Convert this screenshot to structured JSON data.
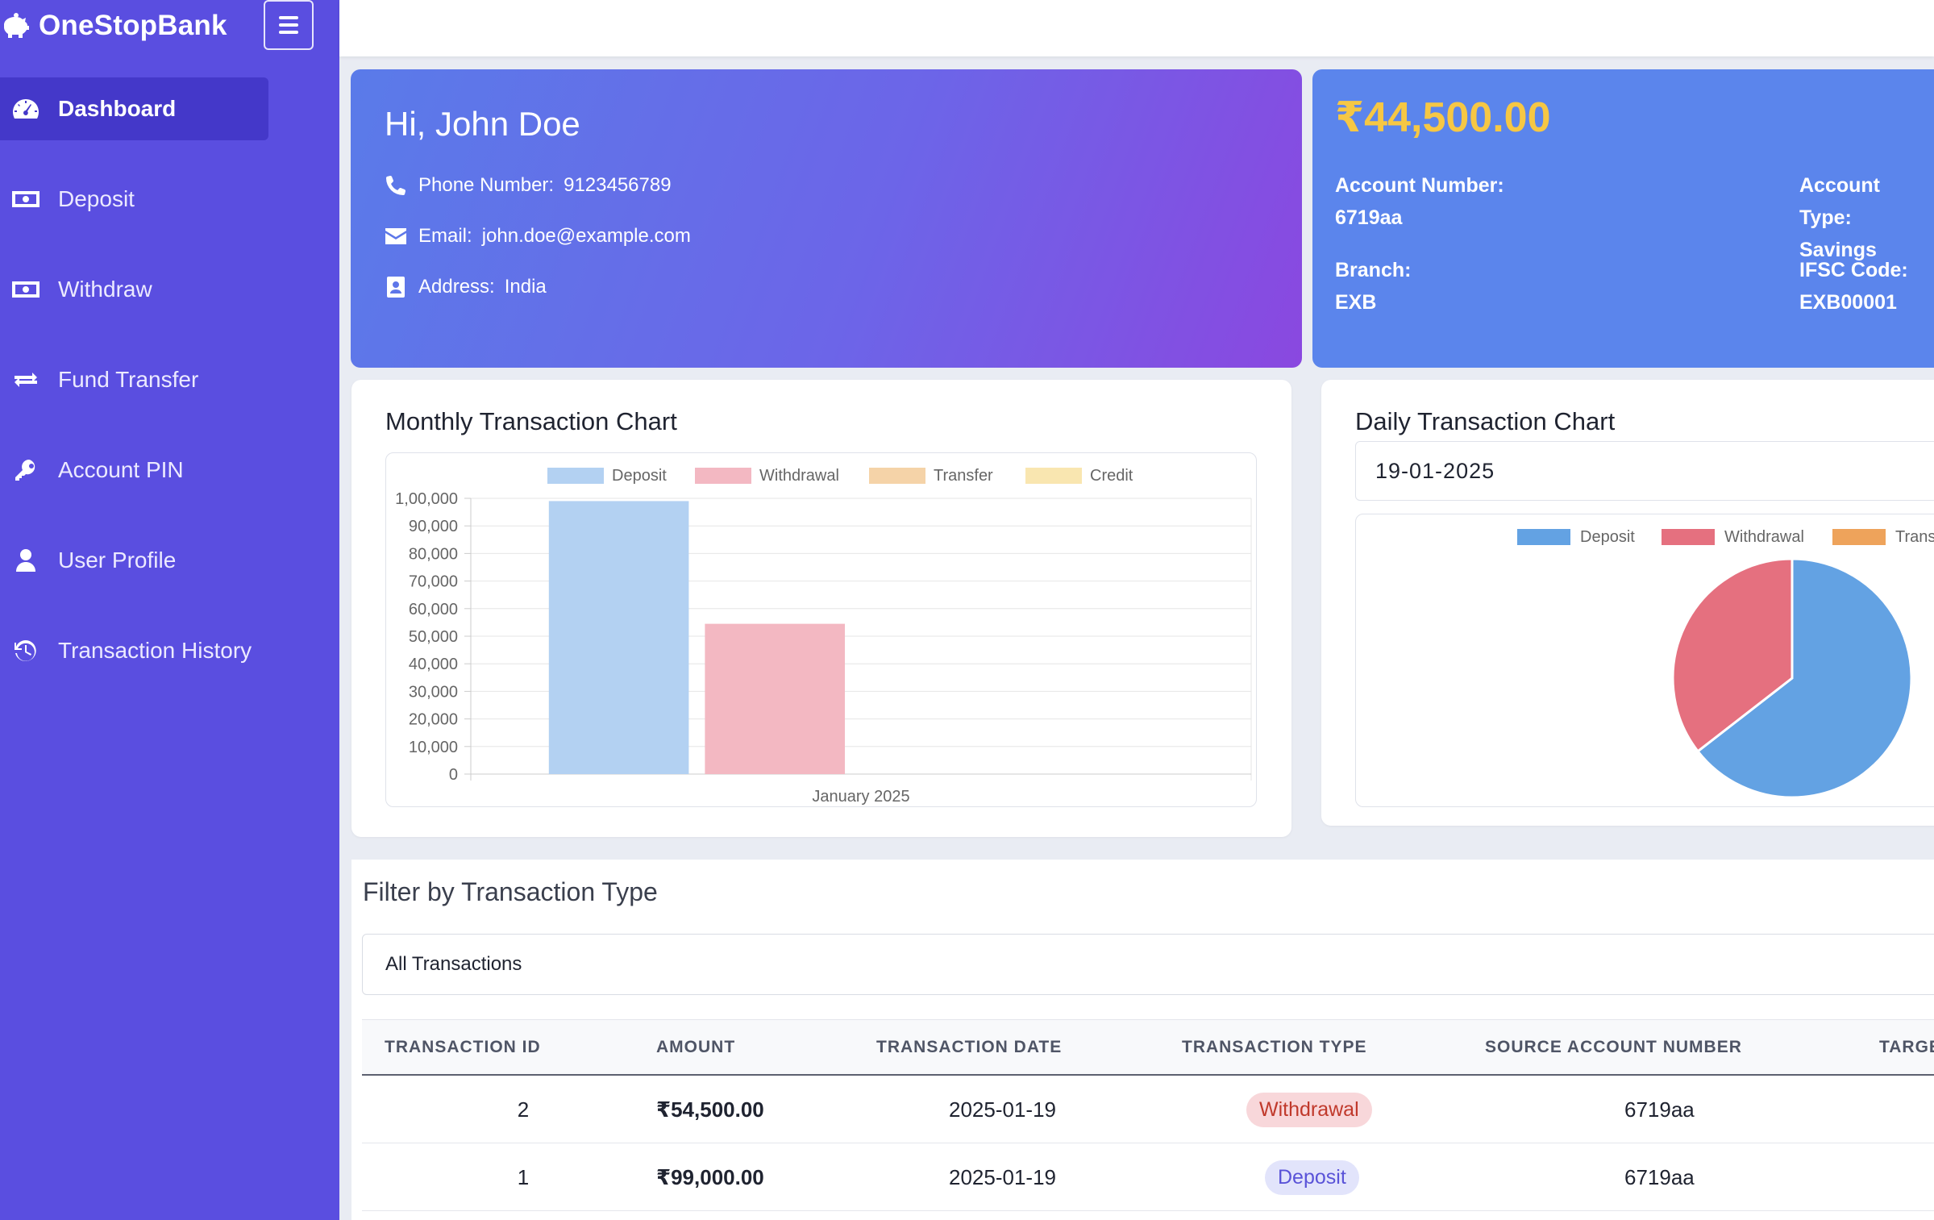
{
  "app": {
    "brand": "OneStopBank"
  },
  "sidebar": {
    "items": [
      {
        "label": "Dashboard",
        "icon": "gauge-icon",
        "active": true
      },
      {
        "label": "Deposit",
        "icon": "money-bill-icon"
      },
      {
        "label": "Withdraw",
        "icon": "money-bill-icon"
      },
      {
        "label": "Fund Transfer",
        "icon": "exchange-arrows-icon"
      },
      {
        "label": "Account PIN",
        "icon": "key-icon"
      },
      {
        "label": "User Profile",
        "icon": "user-icon"
      },
      {
        "label": "Transaction History",
        "icon": "history-icon"
      }
    ]
  },
  "profile": {
    "greeting": "Hi, John Doe",
    "phone_label": "Phone Number:",
    "phone": "9123456789",
    "email_label": "Email:",
    "email": "john.doe@example.com",
    "address_label": "Address:",
    "address": "India"
  },
  "account": {
    "balance": "₹44,500.00",
    "number_label": "Account Number:",
    "number": "6719aa",
    "type_label": "Account Type:",
    "type": "Savings",
    "branch_label": "Branch:",
    "branch": "EXB",
    "ifsc_label": "IFSC Code:",
    "ifsc": "EXB00001"
  },
  "monthly_chart": {
    "title": "Monthly Transaction Chart"
  },
  "daily_chart": {
    "title": "Daily Transaction Chart",
    "date": "19-01-2025"
  },
  "chart_data": [
    {
      "type": "bar",
      "categories": [
        "January 2025"
      ],
      "series": [
        {
          "name": "Deposit",
          "values": [
            99000
          ],
          "color": "#b3d1f2"
        },
        {
          "name": "Withdrawal",
          "values": [
            54500
          ],
          "color": "#f3b8c2"
        },
        {
          "name": "Transfer",
          "values": [
            0
          ],
          "color": "#f5d3a8"
        },
        {
          "name": "Credit",
          "values": [
            0
          ],
          "color": "#f9e6b0"
        }
      ],
      "ylim": [
        0,
        100000
      ],
      "yticks": [
        "0",
        "10,000",
        "20,000",
        "30,000",
        "40,000",
        "50,000",
        "60,000",
        "70,000",
        "80,000",
        "90,000",
        "1,00,000"
      ],
      "legend": "top",
      "grid": true
    },
    {
      "type": "pie",
      "labels": [
        "Deposit",
        "Withdrawal",
        "Transfe"
      ],
      "values": [
        99000,
        54500,
        0
      ],
      "colors": [
        "#63a2e3",
        "#e5707f",
        "#eea35b"
      ],
      "legend": "top"
    }
  ],
  "filter": {
    "title": "Filter by Transaction Type",
    "selected": "All Transactions"
  },
  "table": {
    "columns": [
      "TRANSACTION ID",
      "AMOUNT",
      "TRANSACTION DATE",
      "TRANSACTION TYPE",
      "SOURCE ACCOUNT NUMBER",
      "TARGE"
    ],
    "rows": [
      {
        "id": "2",
        "amount": "₹54,500.00",
        "date": "2025-01-19",
        "type": "Withdrawal",
        "source": "6719aa"
      },
      {
        "id": "1",
        "amount": "₹99,000.00",
        "date": "2025-01-19",
        "type": "Deposit",
        "source": "6719aa"
      }
    ]
  }
}
